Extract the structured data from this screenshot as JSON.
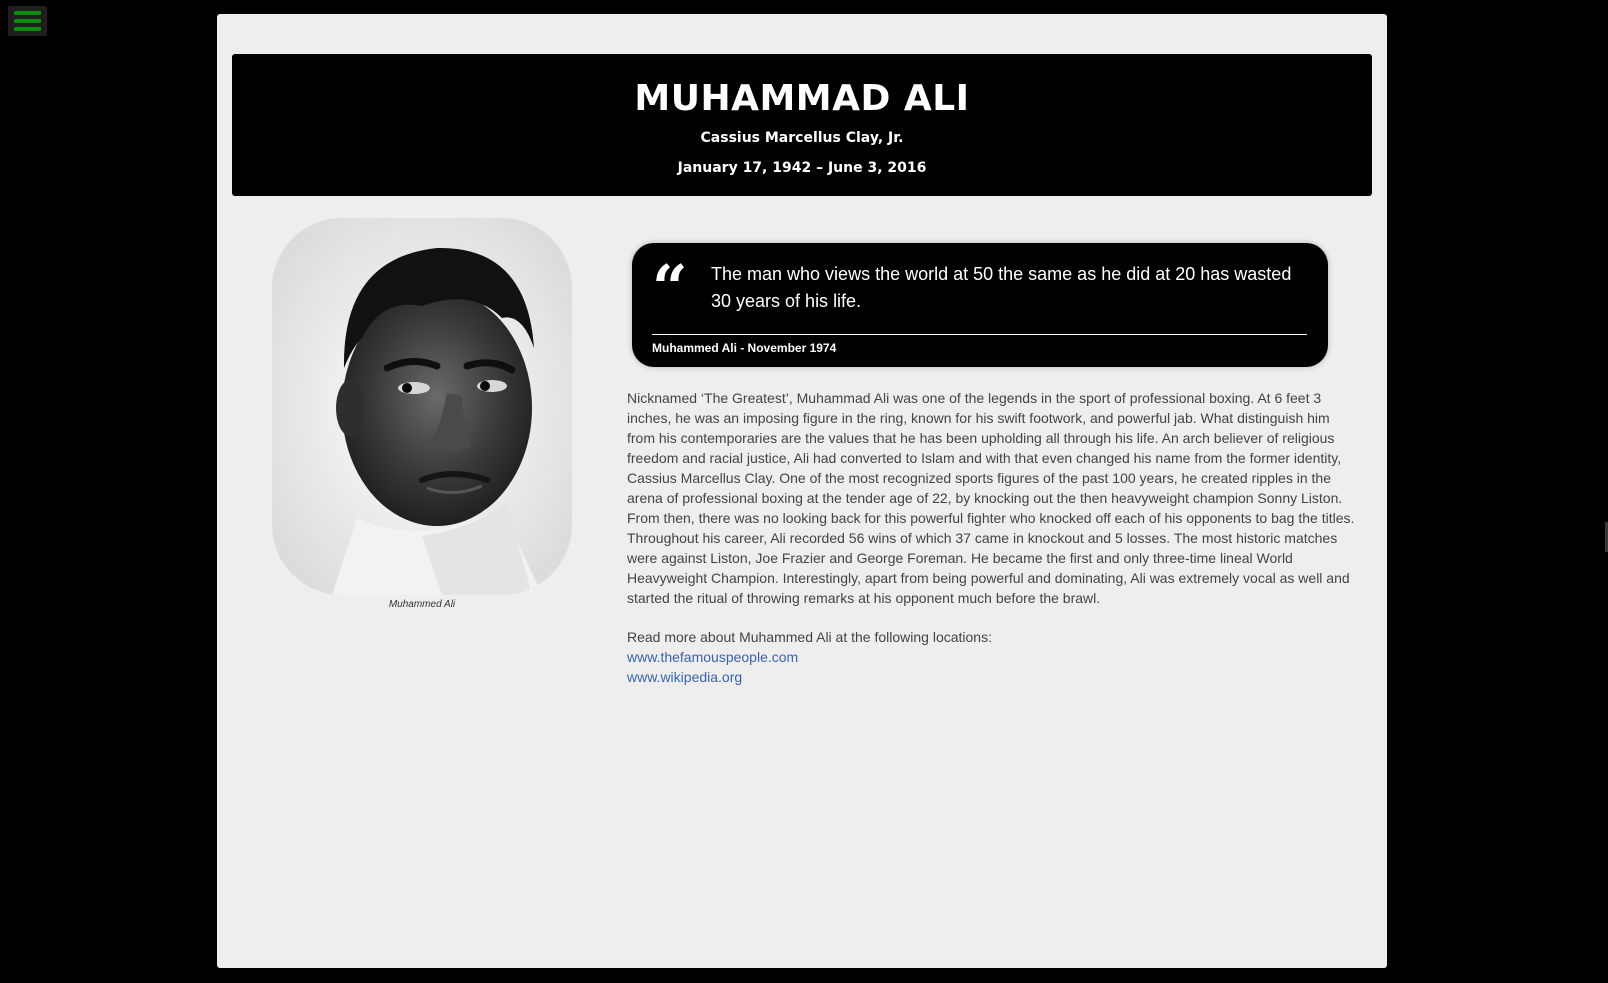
{
  "menu": {
    "icon": "hamburger-menu-icon",
    "accent": "#0e8a0e"
  },
  "header": {
    "title": "MUHAMMAD ALI",
    "birth_name": "Cassius Marcellus Clay, Jr.",
    "dates": "January 17, 1942 – June 3, 2016"
  },
  "portrait": {
    "caption": "Muhammed Ali"
  },
  "quote": {
    "mark": "“",
    "text": "The man who views the world at 50 the same as he did at 20 has wasted 30 years of his life.",
    "attribution": "Muhammed Ali - November 1974"
  },
  "bio": {
    "text": "Nicknamed ‘The Greatest’, Muhammad Ali was one of the legends in the sport of professional boxing. At 6 feet 3 inches, he was an imposing figure in the ring, known for his swift footwork, and powerful jab. What distinguish him from his contemporaries are the values that he has been upholding all through his life. An arch believer of religious freedom and racial justice, Ali had converted to Islam and with that even changed his name from the former identity, Cassius Marcellus Clay. One of the most recognized sports figures of the past 100 years, he created ripples in the arena of professional boxing at the tender age of 22, by knocking out the then heavyweight champion Sonny Liston. From then, there was no looking back for this powerful fighter who knocked off each of his opponents to bag the titles. Throughout his career, Ali recorded 56 wins of which 37 came in knockout and 5 losses. The most historic matches were against Liston, Joe Frazier and George Foreman. He became the first and only three-time lineal World Heavyweight Champion. Interestingly, apart from being powerful and dominating, Ali was extremely vocal as well and started the ritual of throwing remarks at his opponent much before the brawl."
  },
  "read_more": {
    "intro": "Read more about Muhammed Ali at the following locations:",
    "links": [
      "www.thefamouspeople.com",
      "www.wikipedia.org"
    ]
  },
  "colors": {
    "background": "#000000",
    "panel": "#eeeeef",
    "link": "#3b63a8",
    "text": "#444444"
  }
}
